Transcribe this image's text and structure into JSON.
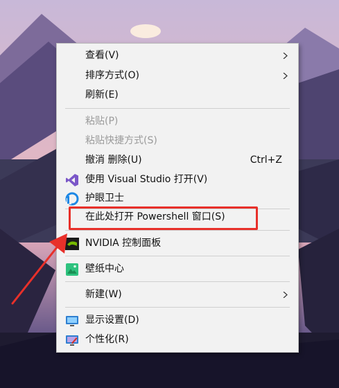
{
  "context_menu": {
    "items": [
      {
        "label": "查看(V)",
        "submenu": true
      },
      {
        "label": "排序方式(O)",
        "submenu": true
      },
      {
        "label": "刷新(E)"
      },
      {
        "label": "粘贴(P)",
        "disabled": true
      },
      {
        "label": "粘贴快捷方式(S)",
        "disabled": true
      },
      {
        "label": "撤消 删除(U)",
        "shortcut": "Ctrl+Z"
      },
      {
        "label": "使用 Visual Studio 打开(V)",
        "icon": "visual-studio-icon"
      },
      {
        "label": "护眼卫士",
        "icon": "eye-guard-icon"
      },
      {
        "label": "在此处打开 Powershell 窗口(S)",
        "highlighted": true
      },
      {
        "label": "NVIDIA 控制面板",
        "icon": "nvidia-icon"
      },
      {
        "label": "壁纸中心",
        "icon": "wallpaper-icon"
      },
      {
        "label": "新建(W)",
        "submenu": true
      },
      {
        "label": "显示设置(D)",
        "icon": "display-icon"
      },
      {
        "label": "个性化(R)",
        "icon": "personalize-icon"
      }
    ]
  },
  "colors": {
    "menu_bg": "#f2f2f2",
    "annotation_red": "#e8302a",
    "disabled_text": "#9a9a9a"
  }
}
